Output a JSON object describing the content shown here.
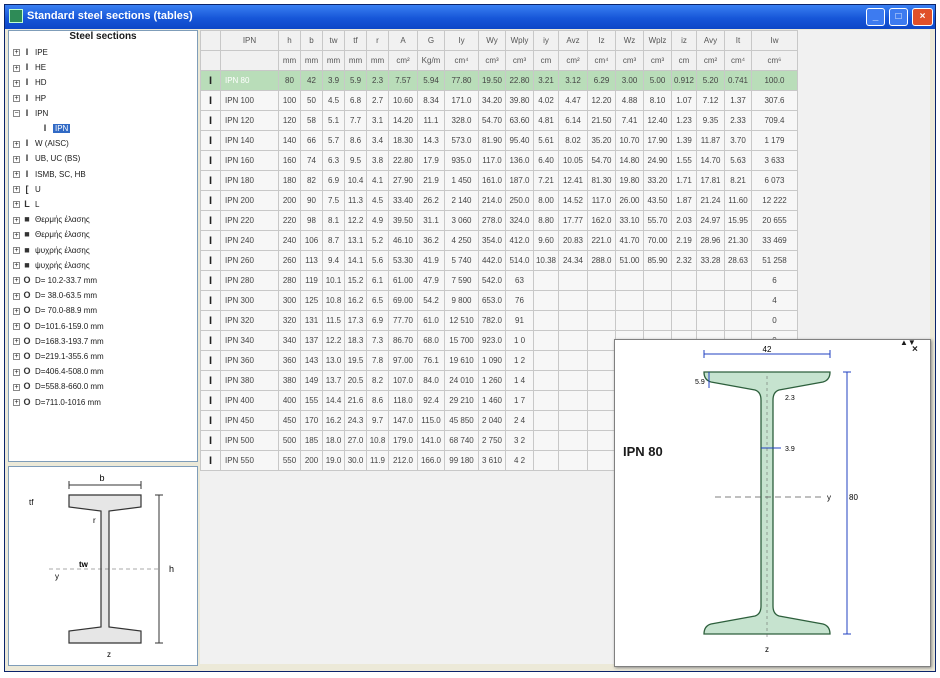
{
  "window": {
    "title": "Standard steel sections (tables)",
    "controls": [
      "_",
      "□",
      "×"
    ]
  },
  "tree": {
    "title": "Steel sections",
    "items": [
      {
        "label": "IPE",
        "toggle": "+",
        "icon": "I"
      },
      {
        "label": "HE",
        "toggle": "+",
        "icon": "I"
      },
      {
        "label": "HD",
        "toggle": "+",
        "icon": "I"
      },
      {
        "label": "HP",
        "toggle": "+",
        "icon": "I"
      },
      {
        "label": "IPN",
        "toggle": "−",
        "icon": "I"
      },
      {
        "label": "IPN",
        "toggle": "",
        "icon": "I",
        "child": true,
        "selected": true
      },
      {
        "label": "W (AISC)",
        "toggle": "+",
        "icon": "I"
      },
      {
        "label": "UB, UC (BS)",
        "toggle": "+",
        "icon": "I"
      },
      {
        "label": "ISMB, SC, HB",
        "toggle": "+",
        "icon": "I"
      },
      {
        "label": "U",
        "toggle": "+",
        "icon": "["
      },
      {
        "label": "L",
        "toggle": "+",
        "icon": "L"
      },
      {
        "label": "Θερμής έλασης",
        "toggle": "+",
        "icon": "■"
      },
      {
        "label": "Θερμής έλασης",
        "toggle": "+",
        "icon": "■"
      },
      {
        "label": "ψυχρής έλασης",
        "toggle": "+",
        "icon": "■"
      },
      {
        "label": "ψυχρής έλασης",
        "toggle": "+",
        "icon": "■"
      },
      {
        "label": "D= 10.2-33.7 mm",
        "toggle": "+",
        "icon": "O"
      },
      {
        "label": "D= 38.0-63.5 mm",
        "toggle": "+",
        "icon": "O"
      },
      {
        "label": "D= 70.0-88.9 mm",
        "toggle": "+",
        "icon": "O"
      },
      {
        "label": "D=101.6-159.0 mm",
        "toggle": "+",
        "icon": "O"
      },
      {
        "label": "D=168.3-193.7 mm",
        "toggle": "+",
        "icon": "O"
      },
      {
        "label": "D=219.1-355.6 mm",
        "toggle": "+",
        "icon": "O"
      },
      {
        "label": "D=406.4-508.0 mm",
        "toggle": "+",
        "icon": "O"
      },
      {
        "label": "D=558.8-660.0 mm",
        "toggle": "+",
        "icon": "O"
      },
      {
        "label": "D=711.0-1016 mm",
        "toggle": "+",
        "icon": "O"
      }
    ]
  },
  "sketch": {
    "b": "b",
    "h": "h",
    "tf": "tf",
    "tw": "tw",
    "r": "r",
    "y": "y",
    "z": "z"
  },
  "table": {
    "headers": [
      "IPN",
      "h",
      "b",
      "tw",
      "tf",
      "r",
      "A",
      "G",
      "Iy",
      "Wy",
      "Wply",
      "iy",
      "Avz",
      "Iz",
      "Wz",
      "Wplz",
      "iz",
      "Avy",
      "It",
      "Iw"
    ],
    "units": [
      "",
      "mm",
      "mm",
      "mm",
      "mm",
      "mm",
      "cm²",
      "Kg/m",
      "cm⁴",
      "cm³",
      "cm³",
      "cm",
      "cm²",
      "cm⁴",
      "cm³",
      "cm³",
      "cm",
      "cm²",
      "cm⁴",
      "cm⁶"
    ],
    "rows": [
      [
        "IPN 80",
        "80",
        "42",
        "3.9",
        "5.9",
        "2.3",
        "7.57",
        "5.94",
        "77.80",
        "19.50",
        "22.80",
        "3.21",
        "3.12",
        "6.29",
        "3.00",
        "5.00",
        "0.912",
        "5.20",
        "0.741",
        "100.0"
      ],
      [
        "IPN 100",
        "100",
        "50",
        "4.5",
        "6.8",
        "2.7",
        "10.60",
        "8.34",
        "171.0",
        "34.20",
        "39.80",
        "4.02",
        "4.47",
        "12.20",
        "4.88",
        "8.10",
        "1.07",
        "7.12",
        "1.37",
        "307.6"
      ],
      [
        "IPN 120",
        "120",
        "58",
        "5.1",
        "7.7",
        "3.1",
        "14.20",
        "11.1",
        "328.0",
        "54.70",
        "63.60",
        "4.81",
        "6.14",
        "21.50",
        "7.41",
        "12.40",
        "1.23",
        "9.35",
        "2.33",
        "709.4"
      ],
      [
        "IPN 140",
        "140",
        "66",
        "5.7",
        "8.6",
        "3.4",
        "18.30",
        "14.3",
        "573.0",
        "81.90",
        "95.40",
        "5.61",
        "8.02",
        "35.20",
        "10.70",
        "17.90",
        "1.39",
        "11.87",
        "3.70",
        "1 179"
      ],
      [
        "IPN 160",
        "160",
        "74",
        "6.3",
        "9.5",
        "3.8",
        "22.80",
        "17.9",
        "935.0",
        "117.0",
        "136.0",
        "6.40",
        "10.05",
        "54.70",
        "14.80",
        "24.90",
        "1.55",
        "14.70",
        "5.63",
        "3 633"
      ],
      [
        "IPN 180",
        "180",
        "82",
        "6.9",
        "10.4",
        "4.1",
        "27.90",
        "21.9",
        "1 450",
        "161.0",
        "187.0",
        "7.21",
        "12.41",
        "81.30",
        "19.80",
        "33.20",
        "1.71",
        "17.81",
        "8.21",
        "6 073"
      ],
      [
        "IPN 200",
        "200",
        "90",
        "7.5",
        "11.3",
        "4.5",
        "33.40",
        "26.2",
        "2 140",
        "214.0",
        "250.0",
        "8.00",
        "14.52",
        "117.0",
        "26.00",
        "43.50",
        "1.87",
        "21.24",
        "11.60",
        "12 222"
      ],
      [
        "IPN 220",
        "220",
        "98",
        "8.1",
        "12.2",
        "4.9",
        "39.50",
        "31.1",
        "3 060",
        "278.0",
        "324.0",
        "8.80",
        "17.77",
        "162.0",
        "33.10",
        "55.70",
        "2.03",
        "24.97",
        "15.95",
        "20 655"
      ],
      [
        "IPN 240",
        "240",
        "106",
        "8.7",
        "13.1",
        "5.2",
        "46.10",
        "36.2",
        "4 250",
        "354.0",
        "412.0",
        "9.60",
        "20.83",
        "221.0",
        "41.70",
        "70.00",
        "2.19",
        "28.96",
        "21.30",
        "33 469"
      ],
      [
        "IPN 260",
        "260",
        "113",
        "9.4",
        "14.1",
        "5.6",
        "53.30",
        "41.9",
        "5 740",
        "442.0",
        "514.0",
        "10.38",
        "24.34",
        "288.0",
        "51.00",
        "85.90",
        "2.32",
        "33.28",
        "28.63",
        "51 258"
      ],
      [
        "IPN 280",
        "280",
        "119",
        "10.1",
        "15.2",
        "6.1",
        "61.00",
        "47.9",
        "7 590",
        "542.0",
        "63",
        "",
        "",
        "",
        "",
        "",
        "",
        "",
        "",
        "6"
      ],
      [
        "IPN 300",
        "300",
        "125",
        "10.8",
        "16.2",
        "6.5",
        "69.00",
        "54.2",
        "9 800",
        "653.0",
        "76",
        "",
        "",
        "",
        "",
        "",
        "",
        "",
        "",
        "4"
      ],
      [
        "IPN 320",
        "320",
        "131",
        "11.5",
        "17.3",
        "6.9",
        "77.70",
        "61.0",
        "12 510",
        "782.0",
        "91",
        "",
        "",
        "",
        "",
        "",
        "",
        "",
        "",
        "0"
      ],
      [
        "IPN 340",
        "340",
        "137",
        "12.2",
        "18.3",
        "7.3",
        "86.70",
        "68.0",
        "15 700",
        "923.0",
        "1 0",
        "",
        "",
        "",
        "",
        "",
        "",
        "",
        "",
        "0"
      ],
      [
        "IPN 360",
        "360",
        "143",
        "13.0",
        "19.5",
        "7.8",
        "97.00",
        "76.1",
        "19 610",
        "1 090",
        "1 2",
        "",
        "",
        "",
        "",
        "",
        "",
        "",
        "",
        "6"
      ],
      [
        "IPN 380",
        "380",
        "149",
        "13.7",
        "20.5",
        "8.2",
        "107.0",
        "84.0",
        "24 010",
        "1 260",
        "1 4",
        "",
        "",
        "",
        "",
        "",
        "",
        "",
        "",
        "6"
      ],
      [
        "IPN 400",
        "400",
        "155",
        "14.4",
        "21.6",
        "8.6",
        "118.0",
        "92.4",
        "29 210",
        "1 460",
        "1 7",
        "",
        "",
        "",
        "",
        "",
        "",
        "",
        "",
        "6"
      ],
      [
        "IPN 450",
        "450",
        "170",
        "16.2",
        "24.3",
        "9.7",
        "147.0",
        "115.0",
        "45 850",
        "2 040",
        "2 4",
        "",
        "",
        "",
        "",
        "",
        "",
        "",
        "",
        "8"
      ],
      [
        "IPN 500",
        "500",
        "185",
        "18.0",
        "27.0",
        "10.8",
        "179.0",
        "141.0",
        "68 740",
        "2 750",
        "3 2",
        "",
        "",
        "",
        "",
        "",
        "",
        "",
        "",
        "8"
      ],
      [
        "IPN 550",
        "550",
        "200",
        "19.0",
        "30.0",
        "11.9",
        "212.0",
        "166.0",
        "99 180",
        "3 610",
        "4 2",
        "",
        "",
        "",
        "",
        "",
        "",
        "",
        "",
        "0"
      ]
    ]
  },
  "popup": {
    "section_label": "IPN 80",
    "dim_b": "42",
    "dim_h": "80",
    "dim_tf": "5.9",
    "dim_tw": "3.9",
    "dim_r": "2.3",
    "axis_y": "y",
    "axis_z": "z",
    "close": "×",
    "arrows": "▲▼",
    "colors": {
      "fill": "#c6e3cf",
      "stroke": "#2d5f3c",
      "dim": "#2040c0"
    }
  },
  "colors": {
    "selected_row": "#b9ddb9",
    "titlebar": "#1656d8",
    "tree_selection": "#316ac5"
  }
}
